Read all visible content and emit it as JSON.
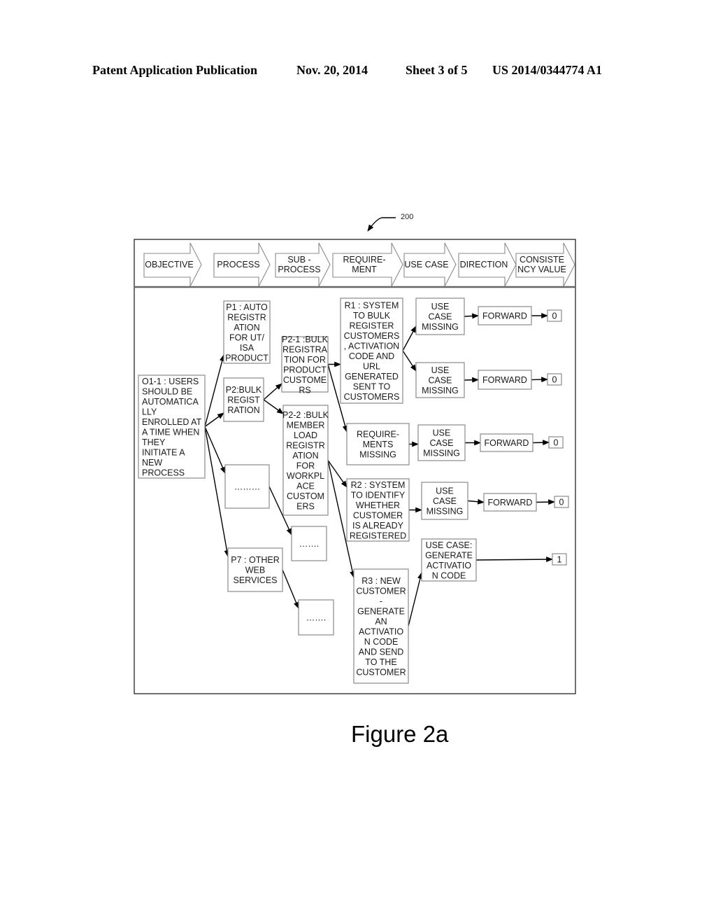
{
  "header": {
    "publication": "Patent Application Publication",
    "date": "Nov. 20, 2014",
    "sheet": "Sheet 3 of 5",
    "number": "US 2014/0344774 A1"
  },
  "figure": {
    "reference_numeral": "200",
    "caption": "Figure 2a"
  },
  "columns": [
    {
      "id": "objective",
      "lines": [
        "OBJECTIVE"
      ]
    },
    {
      "id": "process",
      "lines": [
        "PROCESS"
      ]
    },
    {
      "id": "sub-process",
      "lines": [
        "SUB -",
        "PROCESS"
      ]
    },
    {
      "id": "requirement",
      "lines": [
        "REQUIRE-",
        "MENT"
      ]
    },
    {
      "id": "use-case",
      "lines": [
        "USE CASE"
      ]
    },
    {
      "id": "direction",
      "lines": [
        "DIRECTION"
      ]
    },
    {
      "id": "consistency-value",
      "lines": [
        "CONSISTE",
        "NCY VALUE"
      ]
    }
  ],
  "nodes": [
    {
      "id": "o1",
      "lines": [
        "O1-1 : USERS",
        "SHOULD BE",
        "AUTOMATICA",
        "LLY",
        "ENROLLED AT",
        "A TIME WHEN",
        "THEY",
        "INITIATE A",
        "NEW",
        "PROCESS"
      ]
    },
    {
      "id": "p1",
      "lines": [
        "P1 : AUTO",
        "REGISTR",
        "ATION",
        "FOR UT/",
        "ISA",
        "PRODUCT"
      ]
    },
    {
      "id": "p2",
      "lines": [
        "P2:BULK",
        "REGIST",
        "RATION"
      ]
    },
    {
      "id": "pdots",
      "lines": [
        "………"
      ]
    },
    {
      "id": "p7",
      "lines": [
        "P7 : OTHER",
        "WEB",
        "SERVICES"
      ]
    },
    {
      "id": "p21",
      "lines": [
        "P2-1 :BULK",
        "REGISTRA",
        "TION FOR",
        "PRODUCT",
        "CUSTOME",
        "RS"
      ]
    },
    {
      "id": "p22",
      "lines": [
        "P2-2 :BULK",
        "MEMBER",
        "LOAD",
        "REGISTR",
        "ATION",
        "FOR",
        "WORKPL",
        "ACE",
        "CUSTOM",
        "ERS"
      ]
    },
    {
      "id": "sdots1",
      "lines": [
        "……."
      ]
    },
    {
      "id": "sdots2",
      "lines": [
        "……."
      ]
    },
    {
      "id": "r1",
      "lines": [
        "R1 : SYSTEM",
        "TO BULK",
        "REGISTER",
        "CUSTOMERS",
        ", ACTIVATION",
        "CODE AND",
        "URL",
        "GENERATED",
        "SENT TO",
        "CUSTOMERS"
      ]
    },
    {
      "id": "rmiss",
      "lines": [
        "REQUIRE-",
        "MENTS",
        "MISSING"
      ]
    },
    {
      "id": "r2",
      "lines": [
        "R2 : SYSTEM",
        "TO IDENTIFY",
        "WHETHER",
        "CUSTOMER",
        "IS ALREADY",
        "REGISTERED"
      ]
    },
    {
      "id": "r3",
      "lines": [
        "R3 : NEW",
        "CUSTOMER",
        "-",
        "GENERATE",
        "AN",
        "ACTIVATIO",
        "N CODE",
        "AND SEND",
        "TO THE",
        "CUSTOMER"
      ]
    },
    {
      "id": "uc1",
      "lines": [
        "USE",
        "CASE",
        "MISSING"
      ]
    },
    {
      "id": "uc2",
      "lines": [
        "USE",
        "CASE",
        "MISSING"
      ]
    },
    {
      "id": "uc3",
      "lines": [
        "USE",
        "CASE",
        "MISSING"
      ]
    },
    {
      "id": "uc4",
      "lines": [
        "USE",
        "CASE",
        "MISSING"
      ]
    },
    {
      "id": "uc5",
      "lines": [
        "USE CASE:",
        "GENERATE",
        "ACTIVATIO",
        "N CODE"
      ]
    },
    {
      "id": "d1",
      "lines": [
        "FORWARD"
      ]
    },
    {
      "id": "d2",
      "lines": [
        "FORWARD"
      ]
    },
    {
      "id": "d3",
      "lines": [
        "FORWARD"
      ]
    },
    {
      "id": "d4",
      "lines": [
        "FORWARD"
      ]
    },
    {
      "id": "v1",
      "lines": [
        "0"
      ]
    },
    {
      "id": "v2",
      "lines": [
        "0"
      ]
    },
    {
      "id": "v3",
      "lines": [
        "0"
      ]
    },
    {
      "id": "v4",
      "lines": [
        "0"
      ]
    },
    {
      "id": "v5",
      "lines": [
        "1"
      ]
    }
  ],
  "edges": [
    [
      "o1",
      "p1"
    ],
    [
      "o1",
      "p2"
    ],
    [
      "o1",
      "pdots"
    ],
    [
      "o1",
      "p7"
    ],
    [
      "p2",
      "p21"
    ],
    [
      "p2",
      "p22"
    ],
    [
      "pdots",
      "sdots1"
    ],
    [
      "p7",
      "sdots2"
    ],
    [
      "p21",
      "r1"
    ],
    [
      "p21",
      "rmiss"
    ],
    [
      "p22",
      "r2"
    ],
    [
      "p22",
      "r3"
    ],
    [
      "r1",
      "uc1"
    ],
    [
      "r1",
      "uc2"
    ],
    [
      "rmiss",
      "uc3"
    ],
    [
      "r2",
      "uc4"
    ],
    [
      "r3",
      "uc5"
    ],
    [
      "uc1",
      "d1"
    ],
    [
      "uc2",
      "d2"
    ],
    [
      "uc3",
      "d3"
    ],
    [
      "uc4",
      "d4"
    ],
    [
      "d1",
      "v1"
    ],
    [
      "d2",
      "v2"
    ],
    [
      "d3",
      "v3"
    ],
    [
      "d4",
      "v4"
    ],
    [
      "uc5",
      "v5"
    ]
  ]
}
